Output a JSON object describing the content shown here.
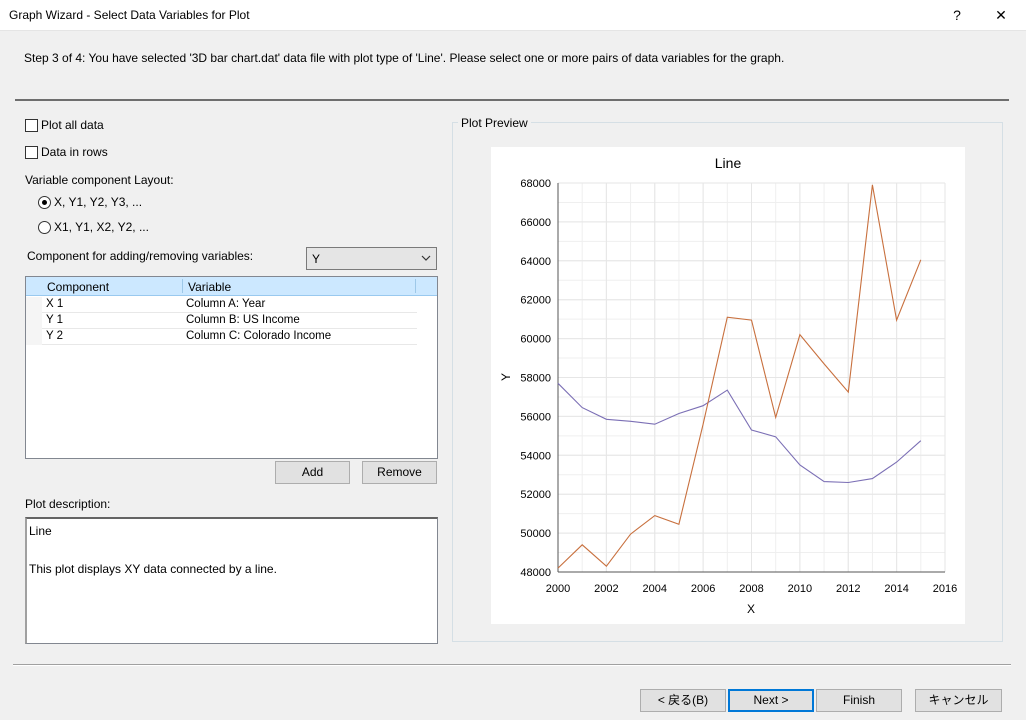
{
  "window": {
    "title": "Graph Wizard - Select Data Variables for Plot",
    "help_glyph": "?",
    "close_glyph": "✕"
  },
  "step_text": "Step 3 of 4:  You have selected '3D bar chart.dat' data file with plot type of 'Line'. Please select one or more pairs of data variables for the graph.",
  "options": {
    "plot_all_data": "Plot all data",
    "plot_all_data_checked": false,
    "data_in_rows": "Data in rows",
    "data_in_rows_checked": false,
    "layout_label": "Variable component Layout:",
    "layout_option_1": "X, Y1, Y2, Y3, ...",
    "layout_option_2": "X1, Y1, X2, Y2, ...",
    "layout_selected": 1
  },
  "component_select": {
    "label": "Component for adding/removing variables:",
    "value": "Y"
  },
  "variables_table": {
    "headers": [
      "Component",
      "Variable"
    ],
    "rows": [
      {
        "component": "X 1",
        "variable": "Column A: Year"
      },
      {
        "component": "Y 1",
        "variable": "Column B: US Income"
      },
      {
        "component": "Y 2",
        "variable": "Column C: Colorado Income"
      }
    ]
  },
  "buttons": {
    "add": "Add",
    "remove": "Remove",
    "back": "< 戻る(B)",
    "next": "Next >",
    "finish": "Finish",
    "cancel": "キャンセル"
  },
  "description": {
    "label": "Plot description:",
    "line1": "Line",
    "line2": "This plot displays XY data connected by a line."
  },
  "preview": {
    "label": "Plot Preview"
  },
  "colors": {
    "series_1": "#7b6fb5",
    "series_2": "#c8703e",
    "grid": "#e6e6e6"
  },
  "chart_data": {
    "type": "line",
    "title": "Line",
    "xlabel": "X",
    "ylabel": "Y",
    "xlim": [
      2000,
      2016
    ],
    "ylim": [
      48000,
      68000
    ],
    "x_ticks": [
      2000,
      2002,
      2004,
      2006,
      2008,
      2010,
      2012,
      2014,
      2016
    ],
    "y_ticks": [
      48000,
      50000,
      52000,
      54000,
      56000,
      58000,
      60000,
      62000,
      64000,
      66000,
      68000
    ],
    "grid": true,
    "x": [
      2000,
      2001,
      2002,
      2003,
      2004,
      2005,
      2006,
      2007,
      2008,
      2009,
      2010,
      2011,
      2012,
      2013,
      2014,
      2015
    ],
    "series": [
      {
        "values": [
          57700,
          56450,
          55850,
          55750,
          55600,
          56150,
          56550,
          57350,
          55300,
          54950,
          53500,
          52650,
          52600,
          52800,
          53650,
          54750
        ]
      },
      {
        "values": [
          48200,
          49400,
          48300,
          49950,
          50900,
          50450,
          55600,
          61100,
          60950,
          55950,
          60200,
          58700,
          57250,
          67900,
          60950,
          64050
        ]
      }
    ]
  }
}
